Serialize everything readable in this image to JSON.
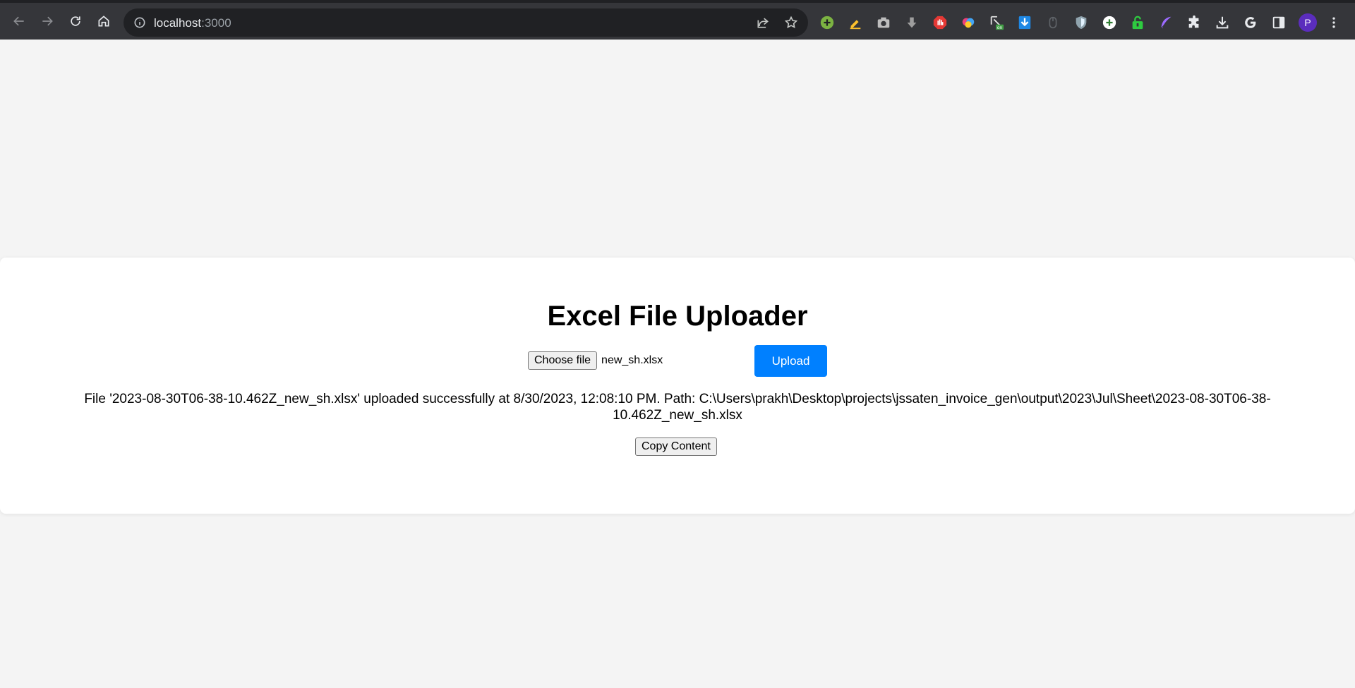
{
  "browser": {
    "url_host": "localhost",
    "url_port": ":3000",
    "profile_initial": "P",
    "extension_icons": [
      "plus-circle-icon",
      "highlighter-icon",
      "camera-icon",
      "download-arrow-icon",
      "stop-hand-icon",
      "brain-icon",
      "cursor-on-icon",
      "download-blue-icon",
      "mouse-icon",
      "shield-icon",
      "plus-outline-icon",
      "lock-green-icon",
      "feather-icon",
      "puzzle-piece-icon",
      "downloads-icon",
      "google-icon",
      "side-panel-icon"
    ],
    "colors": {
      "chrome_bg": "#35363a",
      "omnibox_bg": "#202124",
      "avatar_bg": "#5b2dbd"
    }
  },
  "page": {
    "title": "Excel File Uploader",
    "choose_file_label": "Choose file",
    "selected_file_name": "new_sh.xlsx",
    "upload_label": "Upload",
    "status_message": "File '2023-08-30T06-38-10.462Z_new_sh.xlsx' uploaded successfully at 8/30/2023, 12:08:10 PM. Path: C:\\Users\\prakh\\Desktop\\projects\\jssaten_invoice_gen\\output\\2023\\Jul\\Sheet\\2023-08-30T06-38-10.462Z_new_sh.xlsx",
    "copy_label": "Copy Content",
    "colors": {
      "upload_button": "#0080ff",
      "page_bg": "#f4f4f4",
      "card_bg": "#ffffff"
    }
  }
}
